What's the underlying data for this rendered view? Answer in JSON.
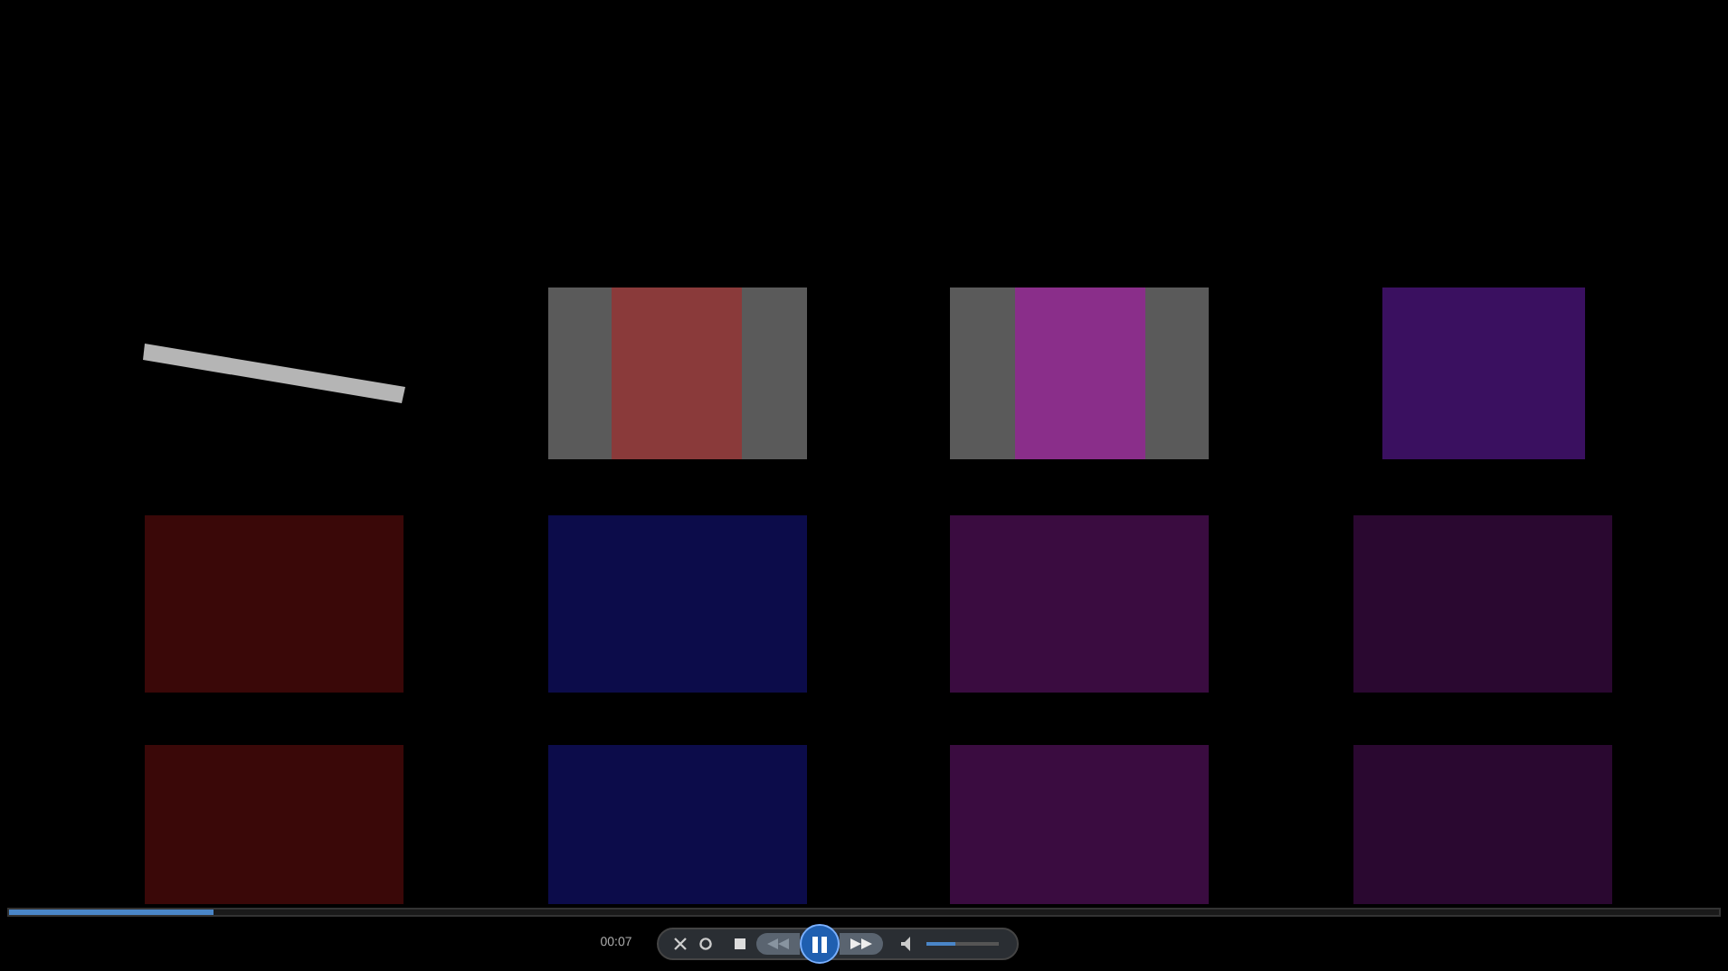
{
  "player": {
    "time": "00:07",
    "playing": true,
    "seek": {
      "level": 0.12
    },
    "volume": {
      "level": 0.4
    }
  }
}
